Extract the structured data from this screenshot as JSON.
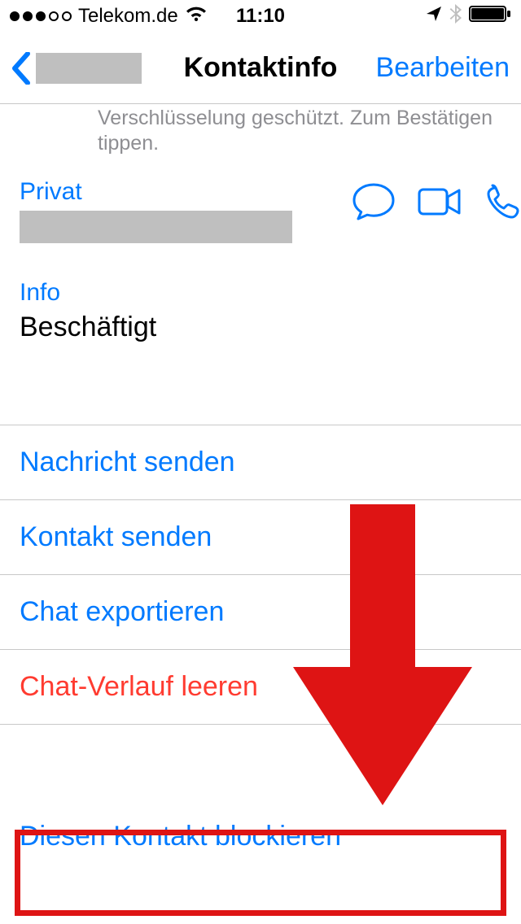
{
  "status": {
    "carrier": "Telekom.de",
    "time": "11:10"
  },
  "nav": {
    "title": "Kontaktinfo",
    "edit": "Bearbeiten"
  },
  "encryption_note": "Verschlüsselung geschützt. Zum Bestätigen tippen.",
  "contact": {
    "phone_label": "Privat",
    "info_label": "Info",
    "info_value": "Beschäftigt"
  },
  "actions": {
    "send_message": "Nachricht senden",
    "send_contact": "Kontakt senden",
    "export_chat": "Chat exportieren",
    "clear_chat": "Chat-Verlauf leeren",
    "block_contact": "Diesen Kontakt blockieren"
  }
}
